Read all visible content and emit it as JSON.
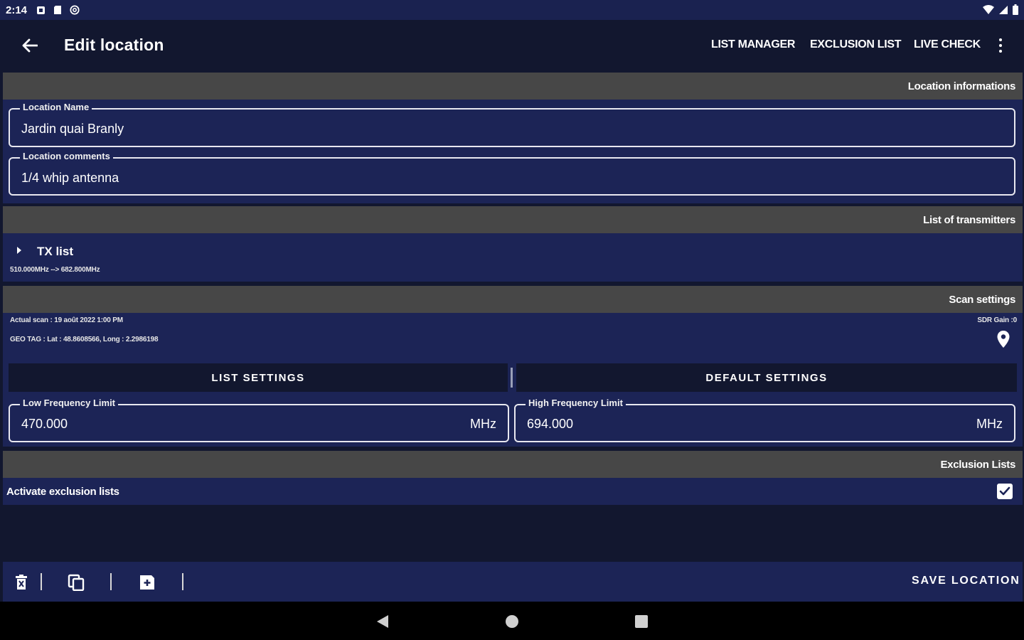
{
  "status_bar": {
    "time": "2:14",
    "icons": [
      "notification-box-icon",
      "sd-card-icon",
      "at-sign-icon",
      "wifi-icon",
      "signal-icon",
      "battery-icon"
    ]
  },
  "app_bar": {
    "title": "Edit location",
    "actions": [
      "LIST MANAGER",
      "EXCLUSION LIST",
      "LIVE CHECK"
    ]
  },
  "location_section": {
    "title": "Location informations",
    "name_label": "Location Name",
    "name_value": "Jardin quai Branly",
    "comments_label": "Location comments",
    "comments_value": "1/4 whip antenna"
  },
  "transmitters_section": {
    "title": "List of transmitters",
    "tx_label": "TX list",
    "tx_range": "510.000MHz --> 682.800MHz"
  },
  "scan_section": {
    "title": "Scan settings",
    "actual_scan": "Actual scan : 19 août 2022 1:00 PM",
    "geo_tag": "GEO TAG : Lat : 48.8608566, Long : 2.2986198",
    "sdr_gain": "SDR Gain :0",
    "tabs": [
      "LIST SETTINGS",
      "DEFAULT SETTINGS"
    ],
    "low_label": "Low Frequency Limit",
    "low_value": "470.000",
    "low_unit": "MHz",
    "high_label": "High Frequency Limit",
    "high_value": "694.000",
    "high_unit": "MHz"
  },
  "exclusion_section": {
    "title": "Exclusion Lists",
    "activate_label": "Activate exclusion lists",
    "activate_checked": true
  },
  "bottom_bar": {
    "save_label": "SAVE LOCATION"
  },
  "colors": {
    "background": "#12172f",
    "panel": "#1c2456",
    "section_header": "#474747"
  }
}
